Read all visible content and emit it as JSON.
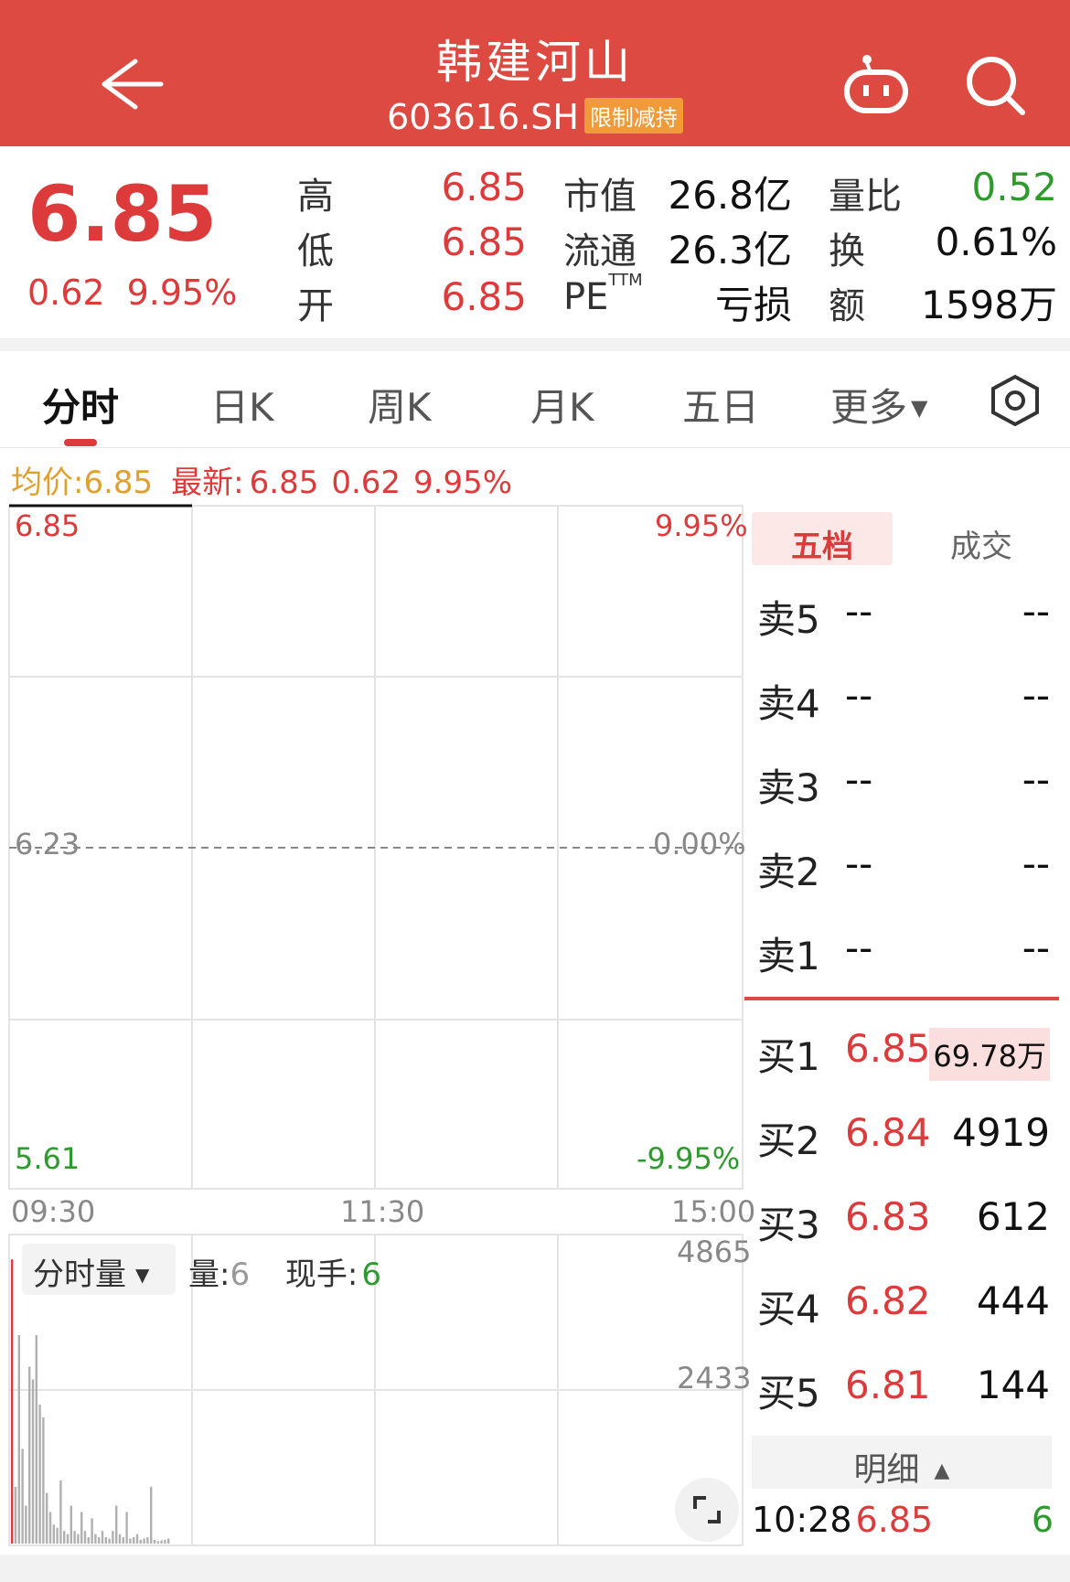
{
  "header": {
    "title": "韩建河山",
    "code": "603616.SH",
    "badge": "限制减持",
    "icons": [
      "back-arrow-icon",
      "robot-icon",
      "search-icon"
    ]
  },
  "quote": {
    "price": "6.85",
    "change": "0.62",
    "change_pct": "9.95%",
    "high_label": "高",
    "high": "6.85",
    "low_label": "低",
    "low": "6.85",
    "open_label": "开",
    "open": "6.85",
    "mcap_label": "市值",
    "mcap": "26.8亿",
    "float_label": "流通",
    "float": "26.3亿",
    "pe_label": "PE",
    "pe_sup": "TTM",
    "pe": "亏损",
    "vratio_label": "量比",
    "vratio": "0.52",
    "turnover_label": "换",
    "turnover": "0.61%",
    "amount_label": "额",
    "amount": "1598万",
    "colors": {
      "up": "#dd3b3b",
      "down": "#2e9a2e",
      "header": "#dd4a41"
    }
  },
  "tabs": [
    {
      "label": "分时",
      "active": true
    },
    {
      "label": "日K"
    },
    {
      "label": "周K"
    },
    {
      "label": "月K"
    },
    {
      "label": "五日"
    },
    {
      "label": "更多"
    }
  ],
  "infoline": {
    "avg_label": "均价:",
    "avg": "6.85",
    "latest_label": "最新:",
    "latest": "6.85",
    "change": "0.62",
    "change_pct": "9.95%"
  },
  "chart": {
    "y_top": "6.85",
    "y_mid": "6.23",
    "y_bottom": "5.61",
    "pct_top": "9.95%",
    "pct_mid": "0.00%",
    "pct_bottom": "-9.95%",
    "x_start": "09:30",
    "x_mid": "11:30",
    "x_end": "15:00"
  },
  "volume": {
    "selector_label": "分时量",
    "vol_label": "量:",
    "vol": "6",
    "hand_label": "现手:",
    "hand": "6",
    "y_top": "4865",
    "y_mid": "2433"
  },
  "chart_data": {
    "type": "bar",
    "title": "",
    "xlabel": "",
    "ylabel": "",
    "ylim": [
      0,
      4865
    ],
    "series": [
      {
        "values": [
          4500,
          900,
          3300,
          1500,
          600,
          2800,
          2600,
          3300,
          2200,
          2000,
          800,
          500,
          300,
          250,
          1000,
          200,
          150,
          600,
          200,
          150,
          500,
          200,
          100,
          400,
          150,
          100,
          200,
          100,
          80,
          200,
          600,
          150,
          100,
          500,
          80,
          100,
          150,
          60,
          80,
          100,
          900,
          60,
          40,
          50,
          60,
          80
        ]
      }
    ]
  },
  "orderbook": {
    "tab_active": "五档",
    "tab_inactive": "成交",
    "asks": [
      {
        "label": "卖5",
        "price": "--",
        "vol": "--"
      },
      {
        "label": "卖4",
        "price": "--",
        "vol": "--"
      },
      {
        "label": "卖3",
        "price": "--",
        "vol": "--"
      },
      {
        "label": "卖2",
        "price": "--",
        "vol": "--"
      },
      {
        "label": "卖1",
        "price": "--",
        "vol": "--"
      }
    ],
    "bids": [
      {
        "label": "买1",
        "price": "6.85",
        "vol": "69.78万"
      },
      {
        "label": "买2",
        "price": "6.84",
        "vol": "4919"
      },
      {
        "label": "买3",
        "price": "6.83",
        "vol": "612"
      },
      {
        "label": "买4",
        "price": "6.82",
        "vol": "444"
      },
      {
        "label": "买5",
        "price": "6.81",
        "vol": "144"
      }
    ],
    "detail_label": "明细",
    "detail": {
      "time": "10:28",
      "price": "6.85",
      "vol": "6"
    }
  }
}
